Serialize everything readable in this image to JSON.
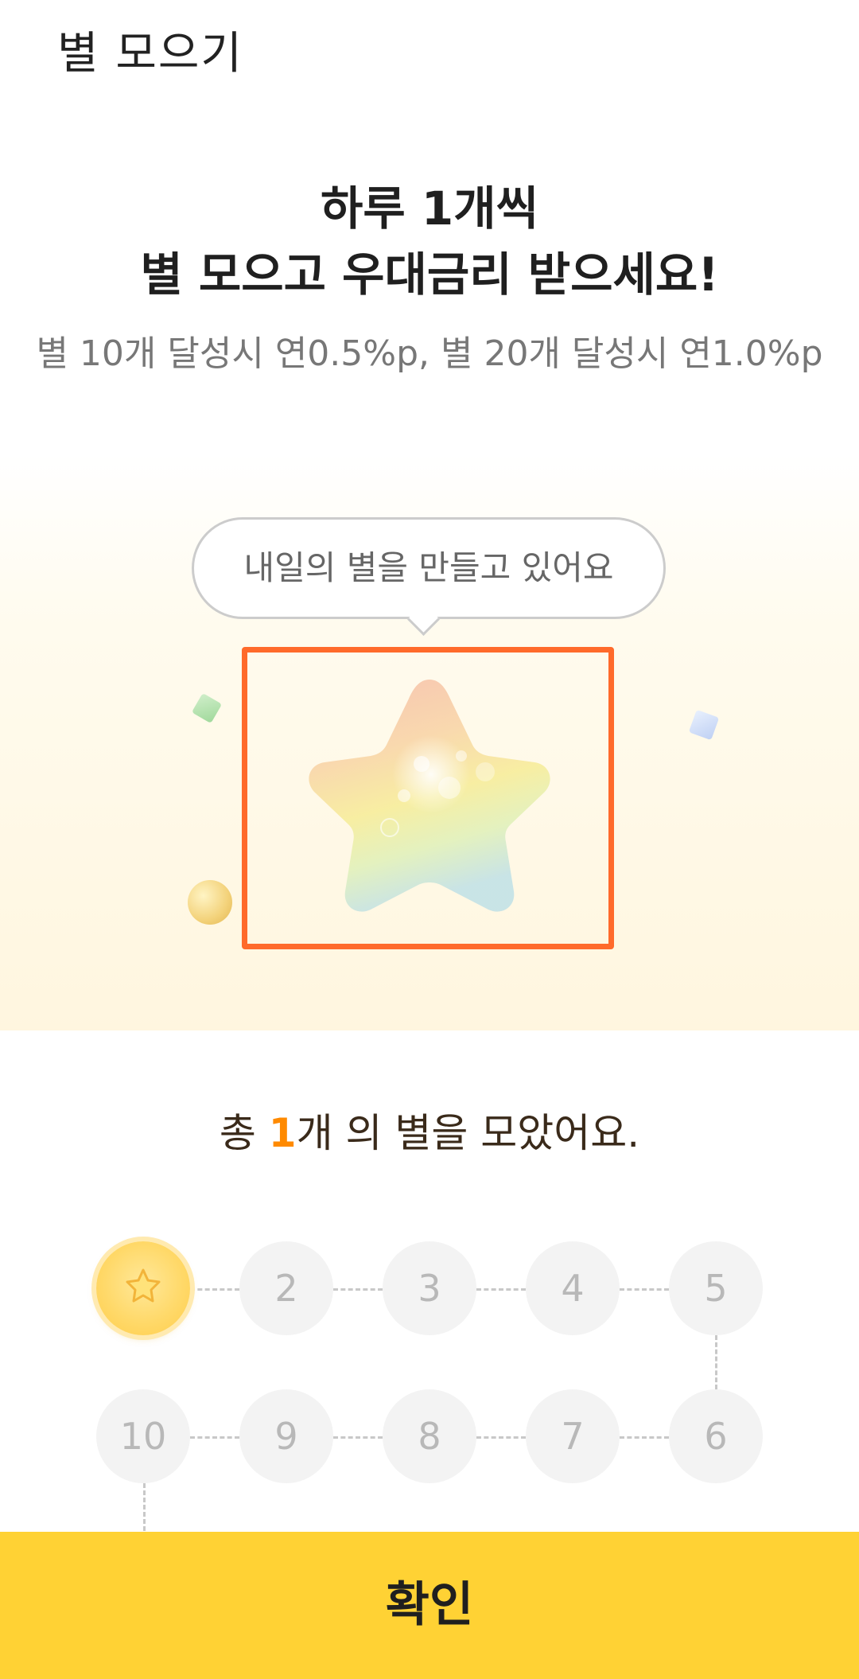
{
  "header": {
    "title": "별 모으기"
  },
  "promo": {
    "headline_line1": "하루 1개씩",
    "headline_line2": "별 모으고 우대금리 받으세요!",
    "subtext": "별 10개 달성시 연0.5%p, 별 20개 달성시 연1.0%p"
  },
  "hero": {
    "bubble_text": "내일의 별을 만들고 있어요"
  },
  "summary": {
    "prefix": "총 ",
    "count": "1",
    "suffix": "개 의 별을 모았어요."
  },
  "tracker": {
    "collected": 1,
    "total": 10,
    "slots": [
      {
        "label": "1",
        "earned": true
      },
      {
        "label": "2",
        "earned": false
      },
      {
        "label": "3",
        "earned": false
      },
      {
        "label": "4",
        "earned": false
      },
      {
        "label": "5",
        "earned": false
      },
      {
        "label": "6",
        "earned": false
      },
      {
        "label": "7",
        "earned": false
      },
      {
        "label": "8",
        "earned": false
      },
      {
        "label": "9",
        "earned": false
      },
      {
        "label": "10",
        "earned": false
      }
    ]
  },
  "actions": {
    "confirm_label": "확인"
  },
  "colors": {
    "accent_yellow": "#ffd234",
    "accent_orange": "#ff8a00",
    "highlight_border": "#ff6a2b"
  },
  "icons": {
    "earned_slot": "star-icon"
  }
}
